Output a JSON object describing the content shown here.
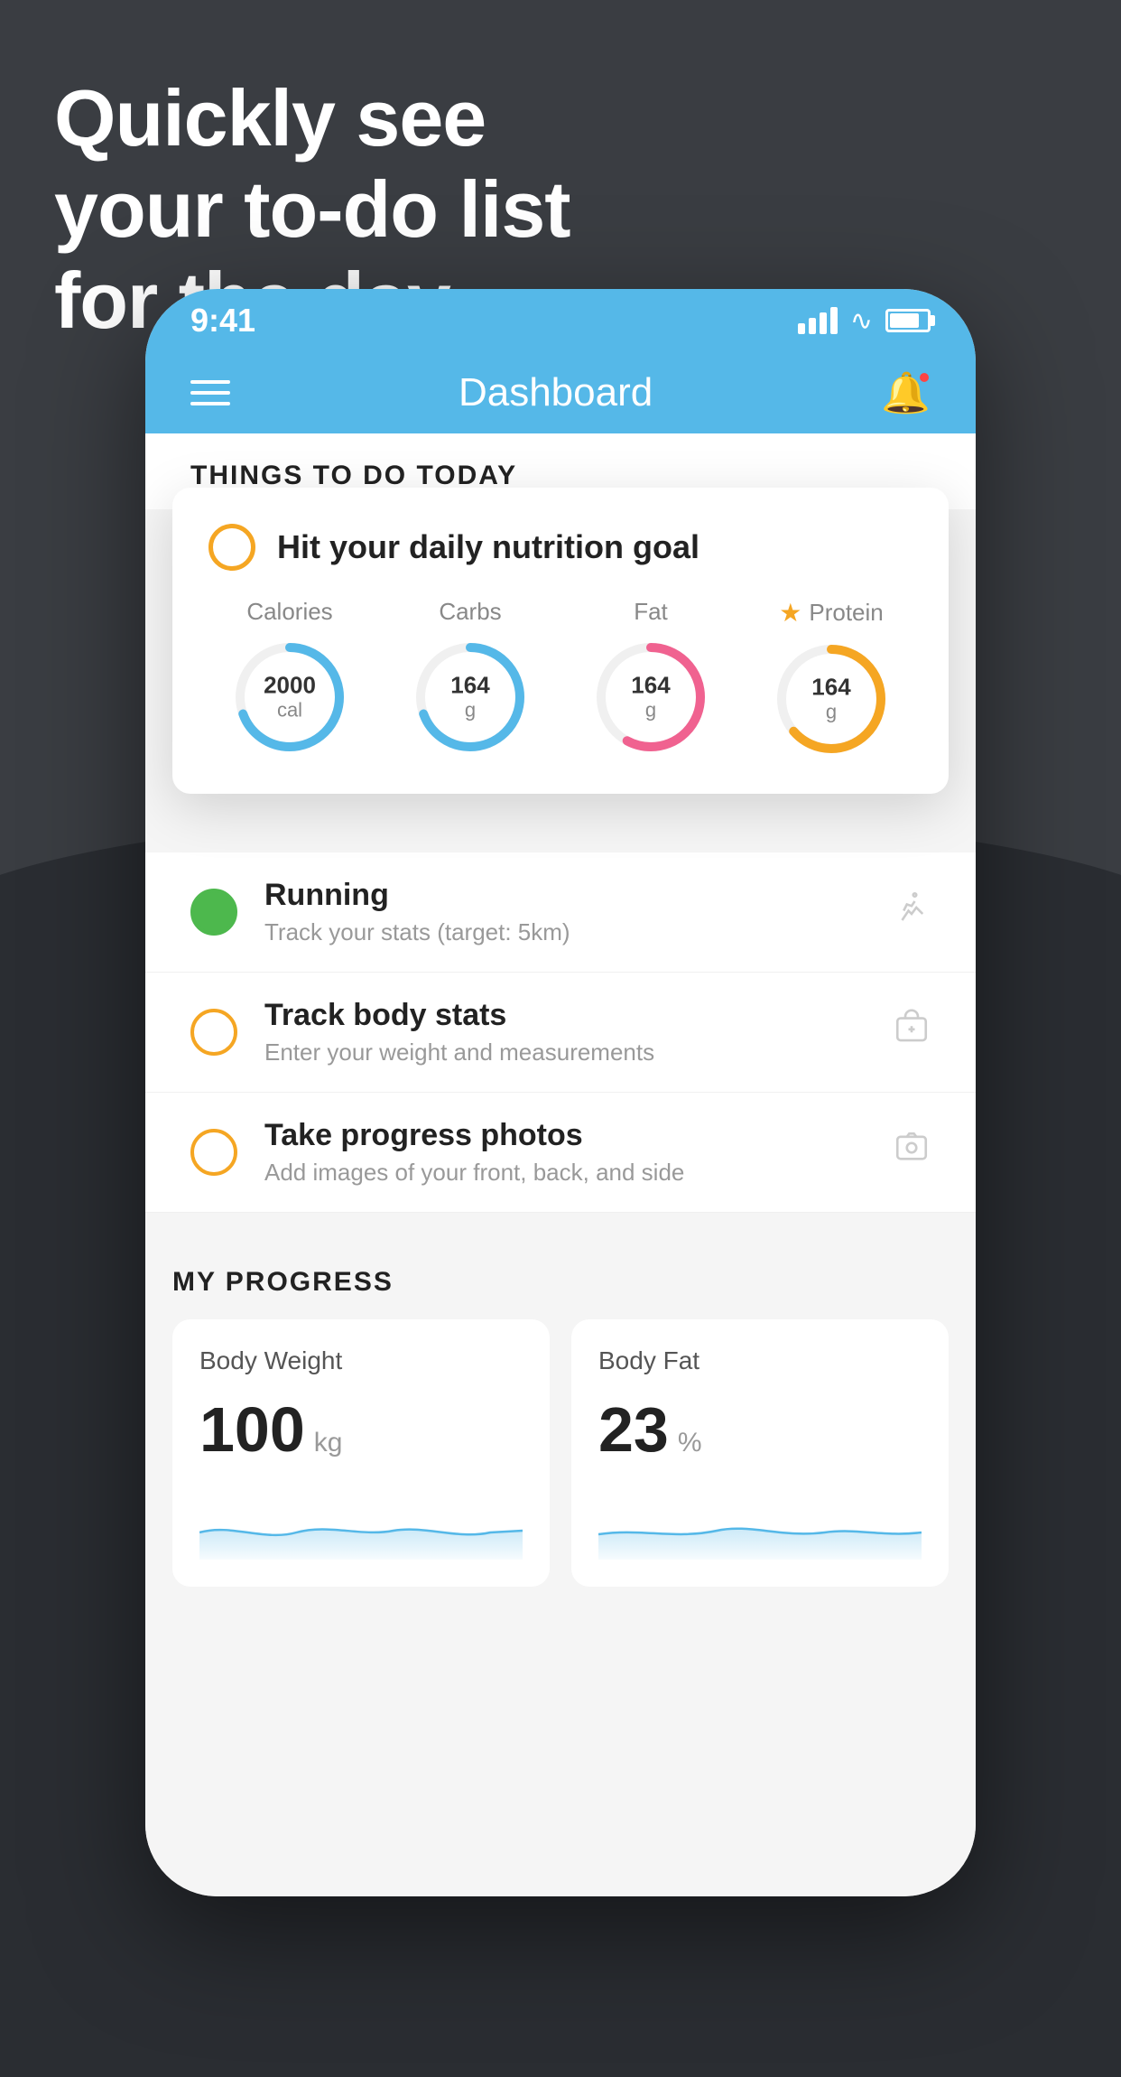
{
  "headline": {
    "line1": "Quickly see",
    "line2": "your to-do list",
    "line3": "for the day."
  },
  "status_bar": {
    "time": "9:41"
  },
  "nav": {
    "title": "Dashboard"
  },
  "things_section": {
    "title": "THINGS TO DO TODAY"
  },
  "nutrition_card": {
    "circle_color": "#f5a623",
    "title": "Hit your daily nutrition goal",
    "metrics": [
      {
        "label": "Calories",
        "value": "2000",
        "unit": "cal",
        "color": "blue",
        "starred": false
      },
      {
        "label": "Carbs",
        "value": "164",
        "unit": "g",
        "color": "blue",
        "starred": false
      },
      {
        "label": "Fat",
        "value": "164",
        "unit": "g",
        "color": "pink",
        "starred": false
      },
      {
        "label": "Protein",
        "value": "164",
        "unit": "g",
        "color": "yellow",
        "starred": true
      }
    ]
  },
  "todo_items": [
    {
      "name": "Running",
      "desc": "Track your stats (target: 5km)",
      "circle_type": "complete",
      "icon": "👟"
    },
    {
      "name": "Track body stats",
      "desc": "Enter your weight and measurements",
      "circle_type": "yellow",
      "icon": "⚖"
    },
    {
      "name": "Take progress photos",
      "desc": "Add images of your front, back, and side",
      "circle_type": "yellow",
      "icon": "🖼"
    }
  ],
  "progress_section": {
    "title": "MY PROGRESS",
    "cards": [
      {
        "title": "Body Weight",
        "value": "100",
        "unit": "kg"
      },
      {
        "title": "Body Fat",
        "value": "23",
        "unit": "%"
      }
    ]
  }
}
